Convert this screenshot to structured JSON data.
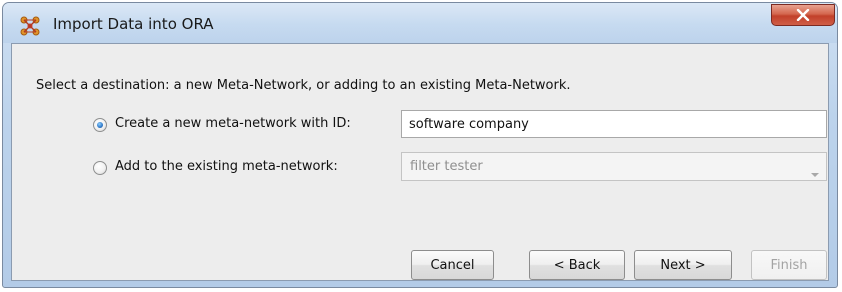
{
  "window": {
    "title": "Import Data into ORA",
    "icon": "ora-app-icon",
    "close_icon": "close-icon"
  },
  "dialog": {
    "instruction": "Select a destination: a new Meta-Network, or adding to an existing Meta-Network.",
    "options": [
      {
        "label": "Create a new meta-network with ID:",
        "selected": true,
        "value": "software company"
      },
      {
        "label": "Add to the existing meta-network:",
        "selected": false,
        "value": "filter tester",
        "disabled": true
      }
    ]
  },
  "buttons": {
    "cancel": "Cancel",
    "back": "< Back",
    "next": "Next >",
    "finish": "Finish",
    "finish_disabled": true
  },
  "colors": {
    "close_button": "#c94a33",
    "title_bar": "#c6daf0",
    "client_background": "#ededed",
    "radio_selected": "#2f78c8"
  }
}
